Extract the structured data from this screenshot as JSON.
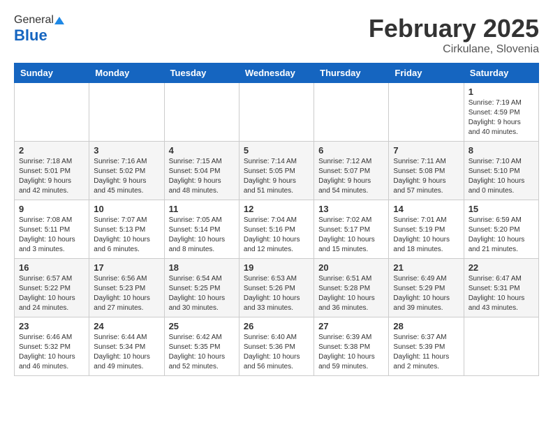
{
  "header": {
    "logo_general": "General",
    "logo_blue": "Blue",
    "month_title": "February 2025",
    "subtitle": "Cirkulane, Slovenia"
  },
  "weekdays": [
    "Sunday",
    "Monday",
    "Tuesday",
    "Wednesday",
    "Thursday",
    "Friday",
    "Saturday"
  ],
  "weeks": [
    [
      {
        "day": "",
        "info": ""
      },
      {
        "day": "",
        "info": ""
      },
      {
        "day": "",
        "info": ""
      },
      {
        "day": "",
        "info": ""
      },
      {
        "day": "",
        "info": ""
      },
      {
        "day": "",
        "info": ""
      },
      {
        "day": "1",
        "info": "Sunrise: 7:19 AM\nSunset: 4:59 PM\nDaylight: 9 hours and 40 minutes."
      }
    ],
    [
      {
        "day": "2",
        "info": "Sunrise: 7:18 AM\nSunset: 5:01 PM\nDaylight: 9 hours and 42 minutes."
      },
      {
        "day": "3",
        "info": "Sunrise: 7:16 AM\nSunset: 5:02 PM\nDaylight: 9 hours and 45 minutes."
      },
      {
        "day": "4",
        "info": "Sunrise: 7:15 AM\nSunset: 5:04 PM\nDaylight: 9 hours and 48 minutes."
      },
      {
        "day": "5",
        "info": "Sunrise: 7:14 AM\nSunset: 5:05 PM\nDaylight: 9 hours and 51 minutes."
      },
      {
        "day": "6",
        "info": "Sunrise: 7:12 AM\nSunset: 5:07 PM\nDaylight: 9 hours and 54 minutes."
      },
      {
        "day": "7",
        "info": "Sunrise: 7:11 AM\nSunset: 5:08 PM\nDaylight: 9 hours and 57 minutes."
      },
      {
        "day": "8",
        "info": "Sunrise: 7:10 AM\nSunset: 5:10 PM\nDaylight: 10 hours and 0 minutes."
      }
    ],
    [
      {
        "day": "9",
        "info": "Sunrise: 7:08 AM\nSunset: 5:11 PM\nDaylight: 10 hours and 3 minutes."
      },
      {
        "day": "10",
        "info": "Sunrise: 7:07 AM\nSunset: 5:13 PM\nDaylight: 10 hours and 6 minutes."
      },
      {
        "day": "11",
        "info": "Sunrise: 7:05 AM\nSunset: 5:14 PM\nDaylight: 10 hours and 8 minutes."
      },
      {
        "day": "12",
        "info": "Sunrise: 7:04 AM\nSunset: 5:16 PM\nDaylight: 10 hours and 12 minutes."
      },
      {
        "day": "13",
        "info": "Sunrise: 7:02 AM\nSunset: 5:17 PM\nDaylight: 10 hours and 15 minutes."
      },
      {
        "day": "14",
        "info": "Sunrise: 7:01 AM\nSunset: 5:19 PM\nDaylight: 10 hours and 18 minutes."
      },
      {
        "day": "15",
        "info": "Sunrise: 6:59 AM\nSunset: 5:20 PM\nDaylight: 10 hours and 21 minutes."
      }
    ],
    [
      {
        "day": "16",
        "info": "Sunrise: 6:57 AM\nSunset: 5:22 PM\nDaylight: 10 hours and 24 minutes."
      },
      {
        "day": "17",
        "info": "Sunrise: 6:56 AM\nSunset: 5:23 PM\nDaylight: 10 hours and 27 minutes."
      },
      {
        "day": "18",
        "info": "Sunrise: 6:54 AM\nSunset: 5:25 PM\nDaylight: 10 hours and 30 minutes."
      },
      {
        "day": "19",
        "info": "Sunrise: 6:53 AM\nSunset: 5:26 PM\nDaylight: 10 hours and 33 minutes."
      },
      {
        "day": "20",
        "info": "Sunrise: 6:51 AM\nSunset: 5:28 PM\nDaylight: 10 hours and 36 minutes."
      },
      {
        "day": "21",
        "info": "Sunrise: 6:49 AM\nSunset: 5:29 PM\nDaylight: 10 hours and 39 minutes."
      },
      {
        "day": "22",
        "info": "Sunrise: 6:47 AM\nSunset: 5:31 PM\nDaylight: 10 hours and 43 minutes."
      }
    ],
    [
      {
        "day": "23",
        "info": "Sunrise: 6:46 AM\nSunset: 5:32 PM\nDaylight: 10 hours and 46 minutes."
      },
      {
        "day": "24",
        "info": "Sunrise: 6:44 AM\nSunset: 5:34 PM\nDaylight: 10 hours and 49 minutes."
      },
      {
        "day": "25",
        "info": "Sunrise: 6:42 AM\nSunset: 5:35 PM\nDaylight: 10 hours and 52 minutes."
      },
      {
        "day": "26",
        "info": "Sunrise: 6:40 AM\nSunset: 5:36 PM\nDaylight: 10 hours and 56 minutes."
      },
      {
        "day": "27",
        "info": "Sunrise: 6:39 AM\nSunset: 5:38 PM\nDaylight: 10 hours and 59 minutes."
      },
      {
        "day": "28",
        "info": "Sunrise: 6:37 AM\nSunset: 5:39 PM\nDaylight: 11 hours and 2 minutes."
      },
      {
        "day": "",
        "info": ""
      }
    ]
  ]
}
